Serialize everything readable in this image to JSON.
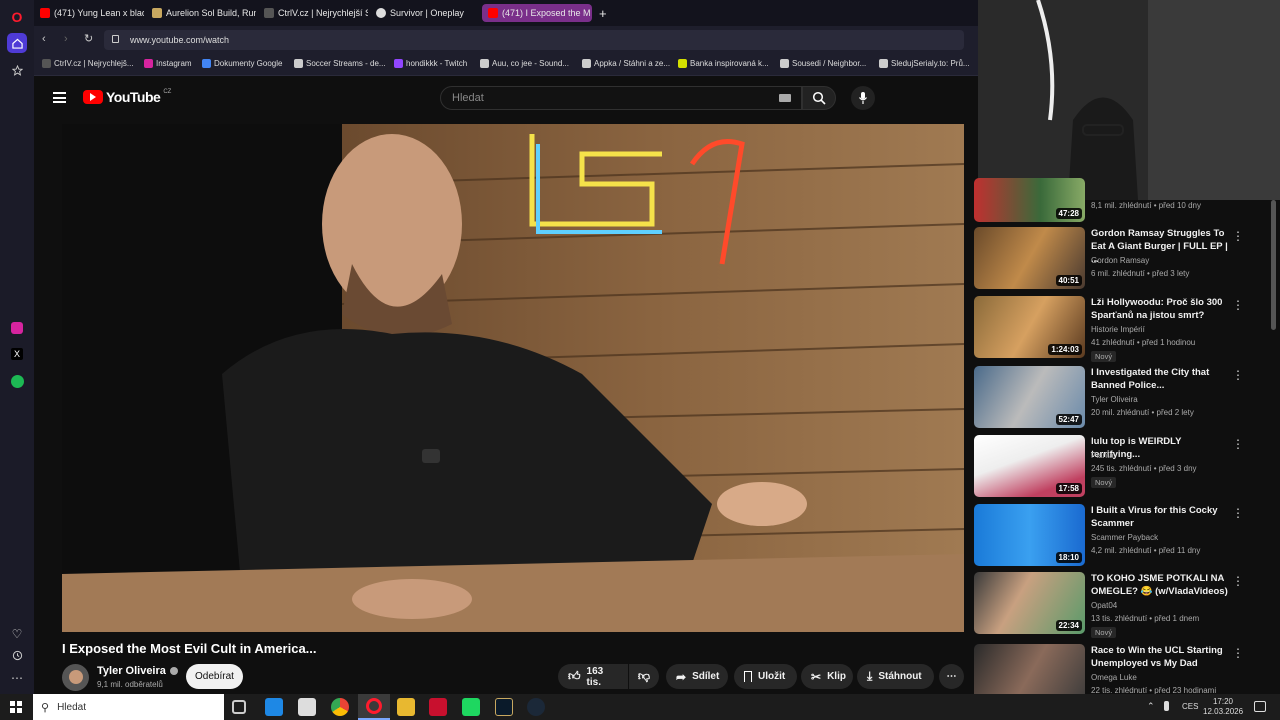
{
  "tabs": [
    {
      "label": "(471) Yung Lean x bladee",
      "color": "#ff0000"
    },
    {
      "label": "Aurelion Sol Build, Runes",
      "color": "#c8a860"
    },
    {
      "label": "CtrlV.cz | Nejrychlejší Scre",
      "color": "#555555"
    },
    {
      "label": "Survivor | Oneplay",
      "color": "#dddddd"
    },
    {
      "label": "(471) I Exposed the M",
      "color": "#ff0000"
    }
  ],
  "address": {
    "url": "www.youtube.com/watch"
  },
  "bookmarks": [
    {
      "label": "CtrlV.cz | Nejrychlejš...",
      "color": "#555555"
    },
    {
      "label": "Instagram",
      "color": "#d6249f"
    },
    {
      "label": "Dokumenty Google",
      "color": "#4285f4"
    },
    {
      "label": "Soccer Streams - de...",
      "color": "#cccccc"
    },
    {
      "label": "hondikkk - Twitch",
      "color": "#9146ff"
    },
    {
      "label": "Auu, co jee - Sound...",
      "color": "#cccccc"
    },
    {
      "label": "Appka / Stáhni a ze...",
      "color": "#cccccc"
    },
    {
      "label": "Banka inspirovaná k...",
      "color": "#d4e000"
    },
    {
      "label": "Sousedi / Neighbor...",
      "color": "#cccccc"
    },
    {
      "label": "SledujSerialy.to: Prů...",
      "color": "#cccccc"
    }
  ],
  "yt": {
    "logo_text": "YouTube",
    "region": "CZ",
    "search_placeholder": "Hledat"
  },
  "video": {
    "title": "I Exposed the Most Evil Cult in America...",
    "channel": "Tyler Oliveira",
    "subscribers": "9,1 mil. odběratelů",
    "subscribe_label": "Odebírat",
    "likes": "163 tis.",
    "share_label": "Sdílet",
    "save_label": "Uložit",
    "clip_label": "Klip",
    "download_label": "Stáhnout"
  },
  "recommendations": [
    {
      "title": "",
      "channel": "",
      "meta": "8,1 mil. zhlédnutí • před 10 dny",
      "duration": "47:28",
      "new": false
    },
    {
      "title": "Gordon Ramsay Struggles To Eat A Giant Burger | FULL EP | ...",
      "channel": "Gordon Ramsay",
      "meta": "6 mil. zhlédnutí • před 3 lety",
      "duration": "40:51",
      "new": false
    },
    {
      "title": "Lži Hollywoodu: Proč šlo 300 Sparťanů na jistou smrt?",
      "channel": "Historie Impérií",
      "meta": "41 zhlédnutí • před 1 hodinou",
      "duration": "1:24:03",
      "new": true
    },
    {
      "title": "I Investigated the City that Banned Police...",
      "channel": "Tyler Oliveira",
      "meta": "20 mil. zhlédnutí • před 2 lety",
      "duration": "52:47",
      "new": false
    },
    {
      "title": "lulu top is WEIRDLY terrifying...",
      "channel": "Pianta",
      "meta": "245 tis. zhlédnutí • před 3 dny",
      "duration": "17:58",
      "new": true
    },
    {
      "title": "I Built a Virus for this Cocky Scammer",
      "channel": "Scammer Payback",
      "meta": "4,2 mil. zhlédnutí • před 11 dny",
      "duration": "18:10",
      "new": false
    },
    {
      "title": "TO KOHO JSME POTKALI NA OMEGLE? 😂 (w/VladaVideos)",
      "channel": "Opat04",
      "meta": "13 tis. zhlédnutí • před 1 dnem",
      "duration": "22:34",
      "new": true
    },
    {
      "title": "Race to Win the UCL Starting Unemployed vs My Dad",
      "channel": "Omega Luke",
      "meta": "22 tis. zhlédnutí • před 23 hodinami",
      "duration": "",
      "new": false
    }
  ],
  "taskbar": {
    "search_placeholder": "Hledat",
    "language": "CES",
    "time": "17:20",
    "date": "12.03.2026"
  },
  "new_badge": "Nový",
  "colors": {
    "accent": "#ff0000",
    "sidebar": "#1b1b28",
    "bg": "#0f0f0f"
  }
}
